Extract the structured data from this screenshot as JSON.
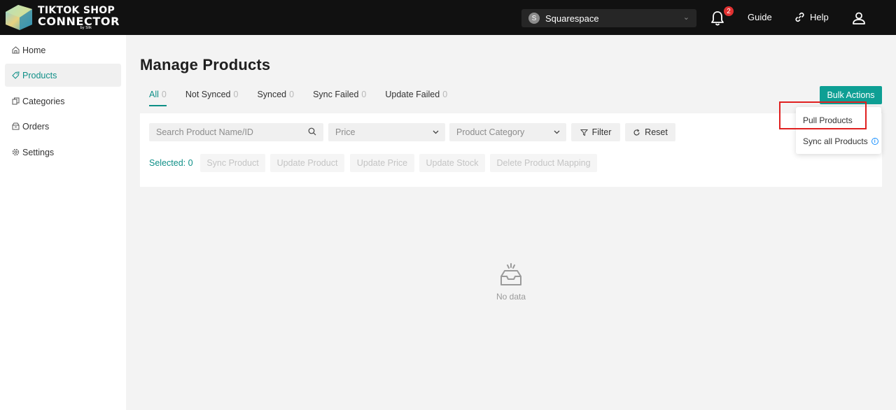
{
  "header": {
    "logo_line1": "TIKTOK SHOP",
    "logo_line2": "CONNECTOR",
    "logo_line3": "by Slik",
    "store_avatar": "S",
    "store_name": "Squarespace",
    "notification_count": "2",
    "guide_label": "Guide",
    "help_label": "Help"
  },
  "sidebar": {
    "items": [
      {
        "label": "Home",
        "icon": "home-icon"
      },
      {
        "label": "Products",
        "icon": "tag-icon"
      },
      {
        "label": "Categories",
        "icon": "copy-icon"
      },
      {
        "label": "Orders",
        "icon": "box-icon"
      },
      {
        "label": "Settings",
        "icon": "gear-icon"
      }
    ]
  },
  "main": {
    "title": "Manage Products",
    "tabs": [
      {
        "label": "All",
        "count": "0"
      },
      {
        "label": "Not Synced",
        "count": "0"
      },
      {
        "label": "Synced",
        "count": "0"
      },
      {
        "label": "Sync Failed",
        "count": "0"
      },
      {
        "label": "Update Failed",
        "count": "0"
      }
    ],
    "bulk_actions_label": "Bulk Actions",
    "bulk_menu": {
      "pull_products": "Pull Products",
      "sync_all_products": "Sync all Products"
    },
    "search_placeholder": "Search Product Name/ID",
    "price_placeholder": "Price",
    "category_placeholder": "Product Category",
    "filter_label": "Filter",
    "reset_label": "Reset",
    "selected_label": "Selected: 0",
    "actions": {
      "sync_product": "Sync Product",
      "update_product": "Update Product",
      "update_price": "Update Price",
      "update_stock": "Update Stock",
      "delete_mapping": "Delete Product Mapping"
    },
    "empty_text": "No data"
  },
  "colors": {
    "accent": "#0e9f94",
    "topbar": "#111111",
    "badge": "#e03131",
    "highlight": "#e02020"
  }
}
